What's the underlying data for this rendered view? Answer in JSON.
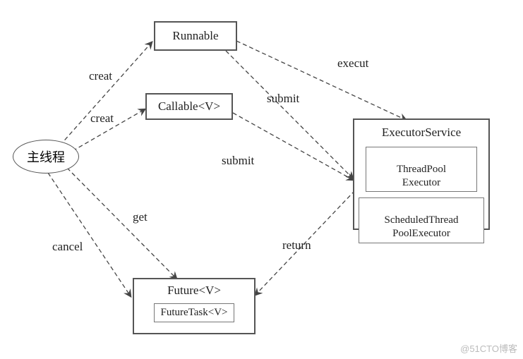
{
  "nodes": {
    "main_thread": "主线程",
    "runnable": "Runnable",
    "callable": "Callable<V>",
    "future": "Future<V>",
    "future_task": "FutureTask<V>",
    "executor_service": "ExecutorService",
    "threadpool_executor": "ThreadPool\nExecutor",
    "scheduled_executor": "ScheduledThread\nPoolExecutor"
  },
  "edges": {
    "creat1": "creat",
    "creat2": "creat",
    "execut": "execut",
    "submit1": "submit",
    "submit2": "submit",
    "get": "get",
    "cancel": "cancel",
    "return": "return"
  },
  "watermark": "@51CTO博客"
}
